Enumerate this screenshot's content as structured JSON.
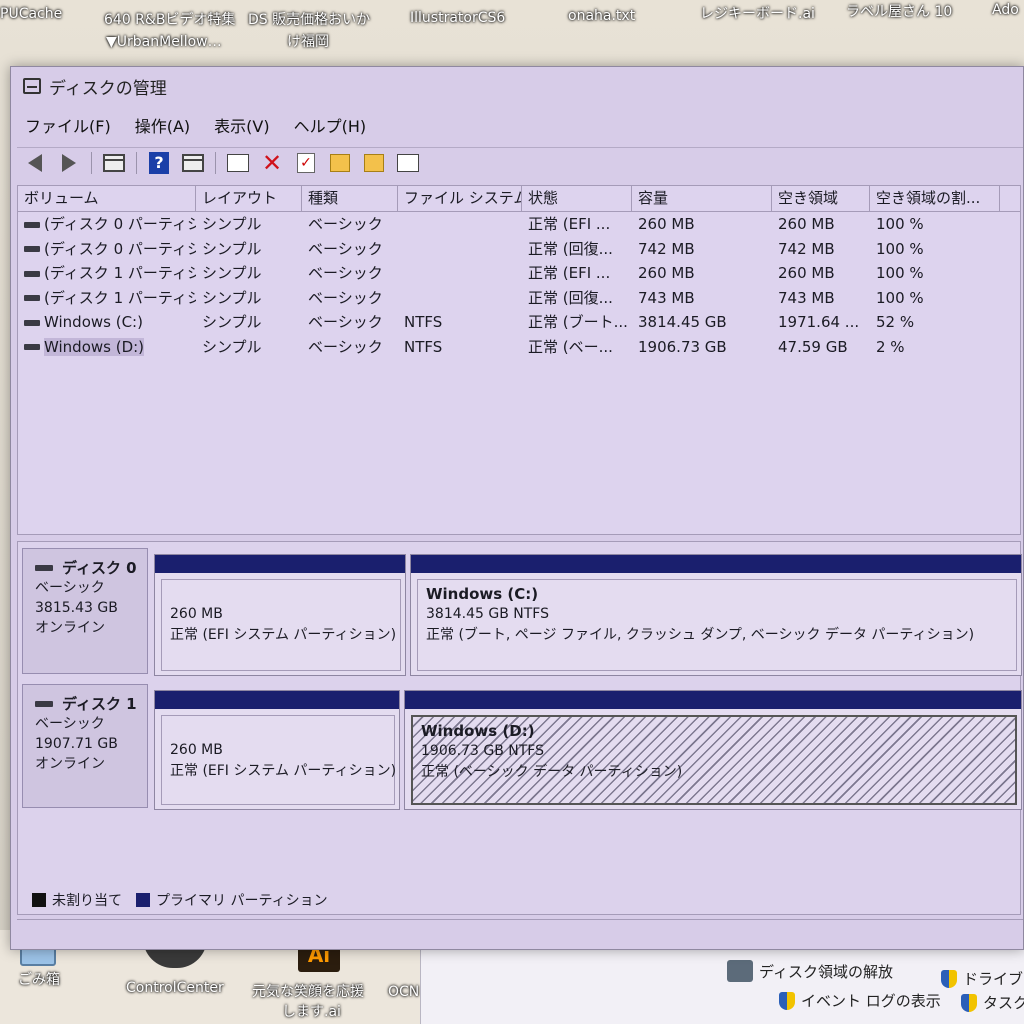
{
  "desktop": {
    "top_icons": [
      "PUCache",
      "640 R&Bビデオ特集",
      "DS 販売価格おいか",
      "IllustratorCS6",
      "onaha.txt",
      "レジキーボード.ai",
      "ラベル屋さん 10",
      "Ado"
    ],
    "top_icons_line2": [
      "▼UrbanMellow…",
      "け福岡"
    ],
    "bottom_icons": [
      "ごみ箱",
      "ControlCenter",
      "元気な笑顔を応援",
      "します.ai",
      "OCN"
    ],
    "ai_badge": "Ai"
  },
  "helper_panel": {
    "items": [
      "ディスク領域の解放",
      "ドライブの",
      "イベント ログの表示",
      "タスク"
    ]
  },
  "window": {
    "title": "ディスクの管理",
    "menu": [
      "ファイル(F)",
      "操作(A)",
      "表示(V)",
      "ヘルプ(H)"
    ],
    "toolbar": {
      "help_glyph": "?",
      "delete_glyph": "✕",
      "check_glyph": "✓"
    }
  },
  "volume_list": {
    "columns": [
      "ボリューム",
      "レイアウト",
      "種類",
      "ファイル システム",
      "状態",
      "容量",
      "空き領域",
      "空き領域の割..."
    ],
    "rows": [
      [
        "(ディスク 0 パーティシ...",
        "シンプル",
        "ベーシック",
        "",
        "正常 (EFI ...",
        "260 MB",
        "260 MB",
        "100 %"
      ],
      [
        "(ディスク 0 パーティシ...",
        "シンプル",
        "ベーシック",
        "",
        "正常 (回復...",
        "742 MB",
        "742 MB",
        "100 %"
      ],
      [
        "(ディスク 1 パーティシ...",
        "シンプル",
        "ベーシック",
        "",
        "正常 (EFI ...",
        "260 MB",
        "260 MB",
        "100 %"
      ],
      [
        "(ディスク 1 パーティシ...",
        "シンプル",
        "ベーシック",
        "",
        "正常 (回復...",
        "743 MB",
        "743 MB",
        "100 %"
      ],
      [
        "Windows (C:)",
        "シンプル",
        "ベーシック",
        "NTFS",
        "正常 (ブート...",
        "3814.45 GB",
        "1971.64 ...",
        "52 %"
      ],
      [
        "Windows (D:)",
        "シンプル",
        "ベーシック",
        "NTFS",
        "正常 (ベー...",
        "1906.73 GB",
        "47.59 GB",
        "2 %"
      ]
    ]
  },
  "disks": [
    {
      "name": "ディスク 0",
      "type": "ベーシック",
      "size": "3815.43 GB",
      "status": "オンライン",
      "partitions": [
        {
          "name": "",
          "size": "260 MB",
          "status": "正常 (EFI システム パーティション)"
        },
        {
          "name": "Windows  (C:)",
          "size": "3814.45 GB NTFS",
          "status": "正常 (ブート, ページ ファイル, クラッシュ ダンプ, ベーシック データ パーティション)"
        }
      ]
    },
    {
      "name": "ディスク 1",
      "type": "ベーシック",
      "size": "1907.71 GB",
      "status": "オンライン",
      "partitions": [
        {
          "name": "",
          "size": "260 MB",
          "status": "正常 (EFI システム パーティション)"
        },
        {
          "name": "Windows  (D:)",
          "size": "1906.73 GB NTFS",
          "status": "正常 (ベーシック データ パーティション)"
        }
      ]
    }
  ],
  "legend": {
    "unallocated": "未割り当て",
    "primary": "プライマリ パーティション",
    "unallocated_color": "#111111",
    "primary_color": "#1a1f6e"
  }
}
